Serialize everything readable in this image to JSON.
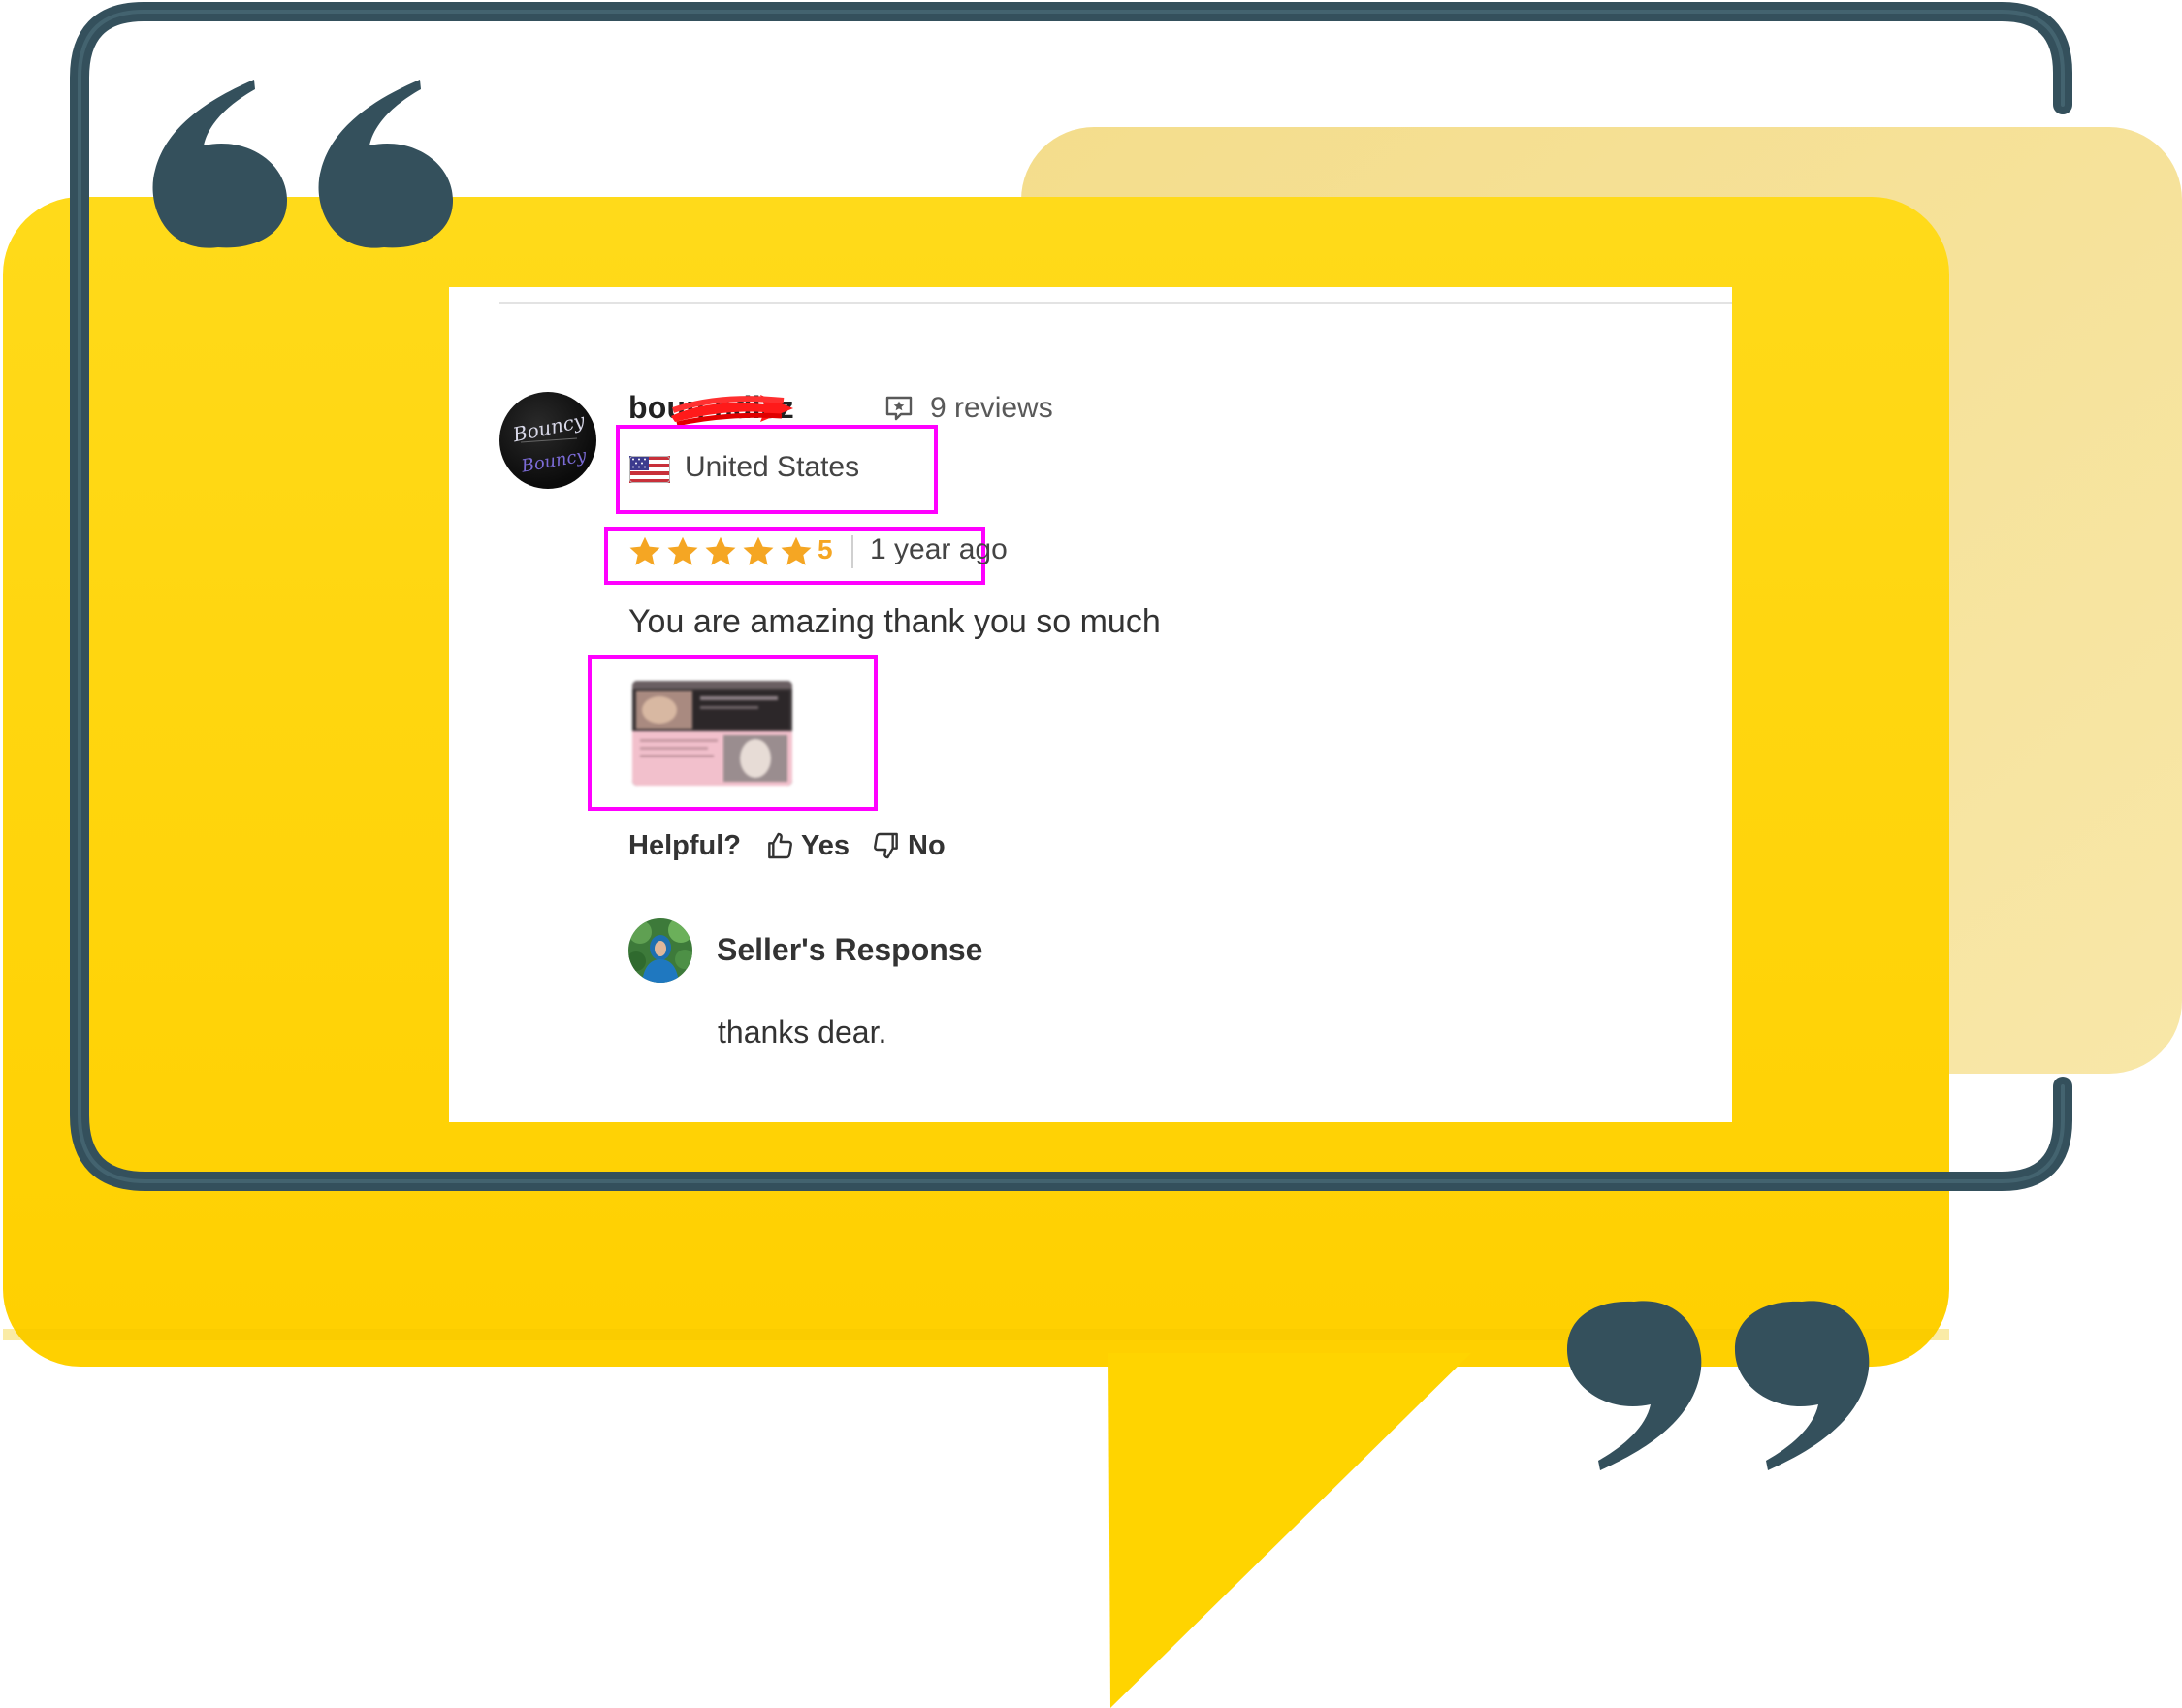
{
  "review": {
    "reviewer_name": "boun        ndlez",
    "reviews_count": "9 reviews",
    "country": "United States",
    "rating": "5",
    "rating_stars": 5,
    "time_ago": "1 year ago",
    "text": "You are amazing thank you so much",
    "avatar_logo_text": "Bouncy"
  },
  "helpful": {
    "label": "Helpful?",
    "yes": "Yes",
    "no": "No"
  },
  "seller_response": {
    "title": "Seller's Response",
    "text": "thanks dear."
  },
  "icons": {
    "reviews": "review-speech-icon",
    "flag": "us-flag-icon",
    "star": "star-icon",
    "thumbs_up": "thumbs-up-icon",
    "thumbs_down": "thumbs-down-icon"
  },
  "colors": {
    "yellow_frame": "#FFD60A",
    "pale_yellow_back": "#F6E39E",
    "frame_outline": "#34505C",
    "highlight": "#FF00FF",
    "star": "#F5A623",
    "redaction": "#FF1A1A"
  }
}
